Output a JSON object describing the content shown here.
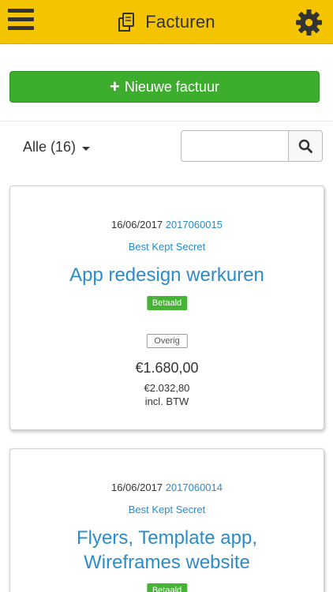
{
  "header": {
    "title": "Facturen",
    "menu_icon": "hamburger-menu-icon",
    "doc_icon": "documents-icon",
    "settings_icon": "gear-icon",
    "bg_color": "#f5c400"
  },
  "actions": {
    "new_invoice_label": "Nieuwe factuur",
    "new_invoice_icon": "plus-icon",
    "button_color": "#3cad2d"
  },
  "filter": {
    "selected": "Alle (16)"
  },
  "search": {
    "value": "",
    "placeholder": "",
    "button_icon": "search-icon"
  },
  "invoices": [
    {
      "date": "16/06/2017",
      "number": "2017060015",
      "client": "Best Kept Secret",
      "title": "App redesign werkuren",
      "status": "Betaald",
      "category": "Overig",
      "amount": "€1.680,00",
      "amount_incl": "€2.032,80",
      "incl_label": "incl. BTW"
    },
    {
      "date": "16/06/2017",
      "number": "2017060014",
      "client": "Best Kept Secret",
      "title_line1": "Flyers, Template app,",
      "title_line2": "Wireframes website",
      "status": "Betaald"
    }
  ]
}
